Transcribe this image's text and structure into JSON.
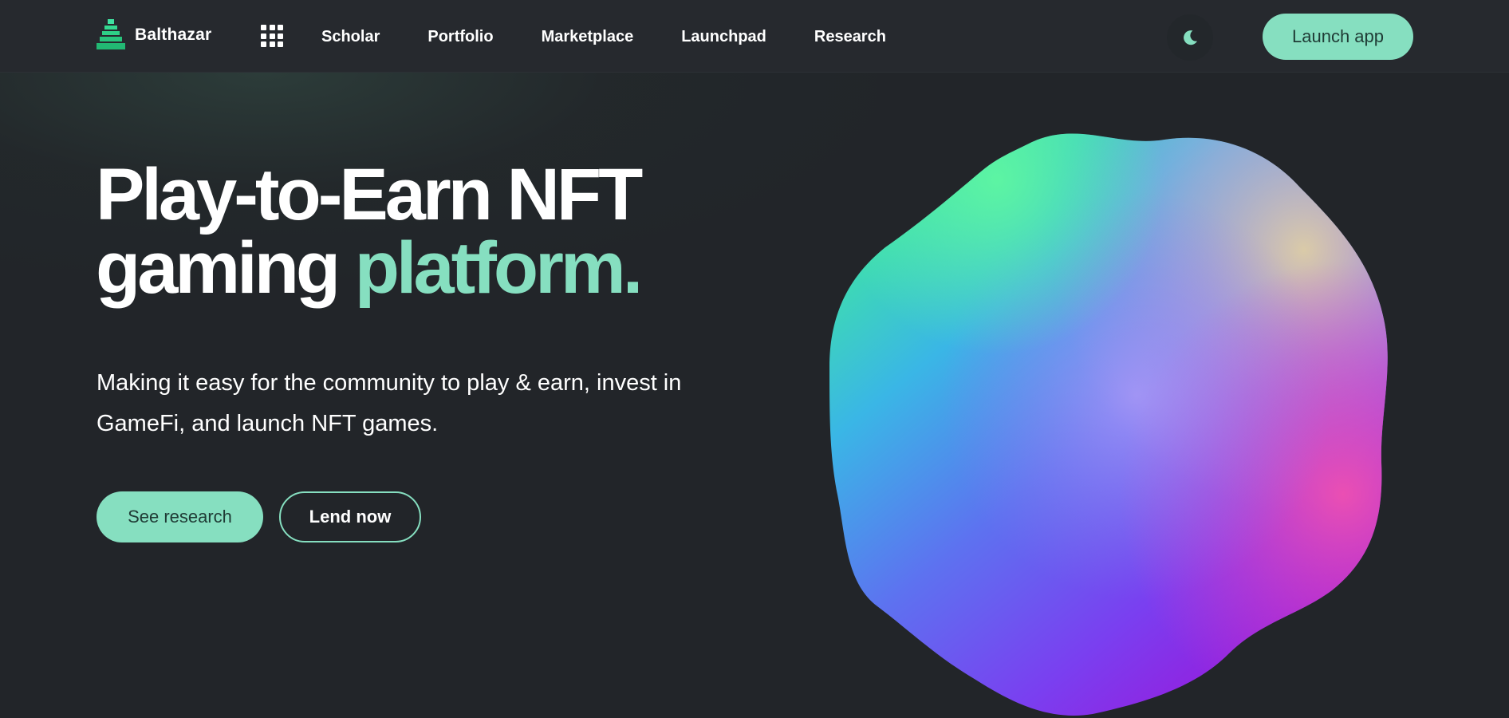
{
  "header": {
    "brand": "Balthazar",
    "nav": [
      {
        "label": "Scholar"
      },
      {
        "label": "Portfolio"
      },
      {
        "label": "Marketplace"
      },
      {
        "label": "Launchpad"
      },
      {
        "label": "Research"
      }
    ],
    "launch_label": "Launch app"
  },
  "hero": {
    "title_line1": "Play-to-Earn NFT",
    "title_line2_plain": "gaming ",
    "title_line2_accent": "platform.",
    "subtitle": "Making it easy for the community to play & earn, invest in GameFi, and launch NFT games.",
    "primary_label": "See research",
    "secondary_label": "Lend now"
  },
  "icons": {
    "logo": "tower-logo-icon",
    "apps": "grid-apps-icon",
    "theme": "moon-icon"
  },
  "colors": {
    "background": "#222529",
    "header": "#26292e",
    "accent": "#86dfc0",
    "accent_text": "#1f3b35",
    "text": "#ffffff"
  }
}
